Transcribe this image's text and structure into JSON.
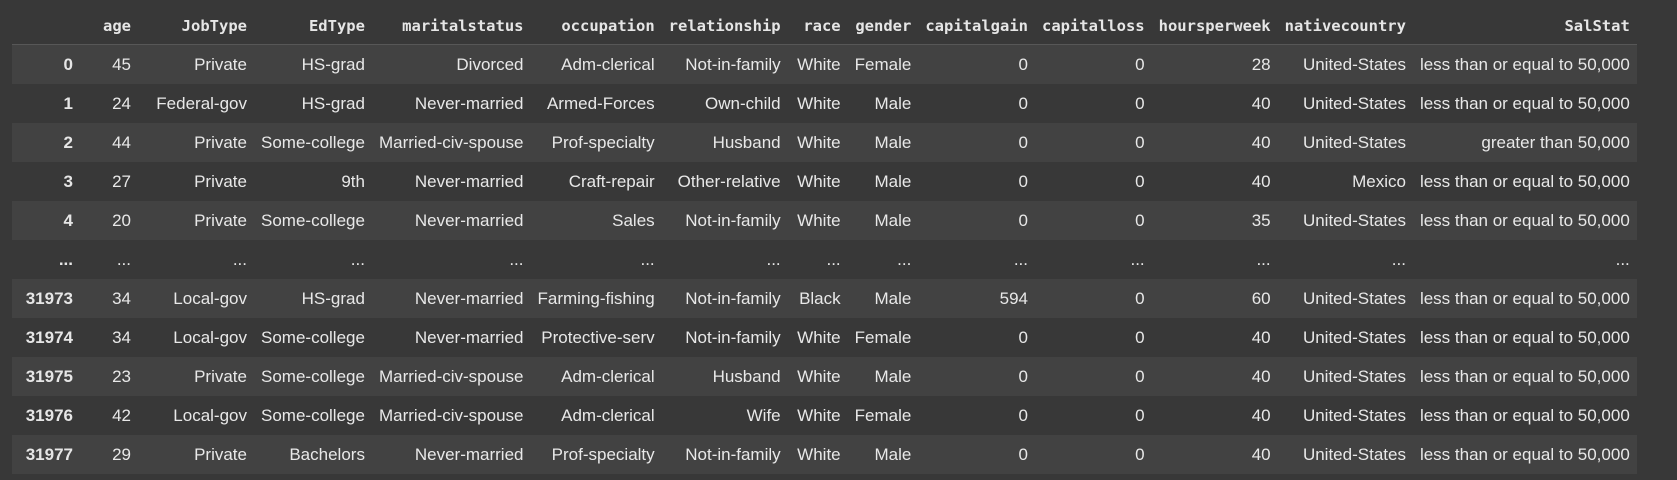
{
  "columns": [
    "",
    "age",
    "JobType",
    "EdType",
    "maritalstatus",
    "occupation",
    "relationship",
    "race",
    "gender",
    "capitalgain",
    "capitalloss",
    "hoursperweek",
    "nativecountry",
    "SalStat"
  ],
  "rows": [
    [
      "0",
      "45",
      "Private",
      "HS-grad",
      "Divorced",
      "Adm-clerical",
      "Not-in-family",
      "White",
      "Female",
      "0",
      "0",
      "28",
      "United-States",
      "less than or equal to 50,000"
    ],
    [
      "1",
      "24",
      "Federal-gov",
      "HS-grad",
      "Never-married",
      "Armed-Forces",
      "Own-child",
      "White",
      "Male",
      "0",
      "0",
      "40",
      "United-States",
      "less than or equal to 50,000"
    ],
    [
      "2",
      "44",
      "Private",
      "Some-college",
      "Married-civ-spouse",
      "Prof-specialty",
      "Husband",
      "White",
      "Male",
      "0",
      "0",
      "40",
      "United-States",
      "greater than 50,000"
    ],
    [
      "3",
      "27",
      "Private",
      "9th",
      "Never-married",
      "Craft-repair",
      "Other-relative",
      "White",
      "Male",
      "0",
      "0",
      "40",
      "Mexico",
      "less than or equal to 50,000"
    ],
    [
      "4",
      "20",
      "Private",
      "Some-college",
      "Never-married",
      "Sales",
      "Not-in-family",
      "White",
      "Male",
      "0",
      "0",
      "35",
      "United-States",
      "less than or equal to 50,000"
    ],
    [
      "...",
      "...",
      "...",
      "...",
      "...",
      "...",
      "...",
      "...",
      "...",
      "...",
      "...",
      "...",
      "...",
      "..."
    ],
    [
      "31973",
      "34",
      "Local-gov",
      "HS-grad",
      "Never-married",
      "Farming-fishing",
      "Not-in-family",
      "Black",
      "Male",
      "594",
      "0",
      "60",
      "United-States",
      "less than or equal to 50,000"
    ],
    [
      "31974",
      "34",
      "Local-gov",
      "Some-college",
      "Never-married",
      "Protective-serv",
      "Not-in-family",
      "White",
      "Female",
      "0",
      "0",
      "40",
      "United-States",
      "less than or equal to 50,000"
    ],
    [
      "31975",
      "23",
      "Private",
      "Some-college",
      "Married-civ-spouse",
      "Adm-clerical",
      "Husband",
      "White",
      "Male",
      "0",
      "0",
      "40",
      "United-States",
      "less than or equal to 50,000"
    ],
    [
      "31976",
      "42",
      "Local-gov",
      "Some-college",
      "Married-civ-spouse",
      "Adm-clerical",
      "Wife",
      "White",
      "Female",
      "0",
      "0",
      "40",
      "United-States",
      "less than or equal to 50,000"
    ],
    [
      "31977",
      "29",
      "Private",
      "Bachelors",
      "Never-married",
      "Prof-specialty",
      "Not-in-family",
      "White",
      "Male",
      "0",
      "0",
      "40",
      "United-States",
      "less than or equal to 50,000"
    ]
  ],
  "colors": {
    "background": "#383838",
    "row_stripe": "#424242",
    "text": "#e8e8e8"
  }
}
